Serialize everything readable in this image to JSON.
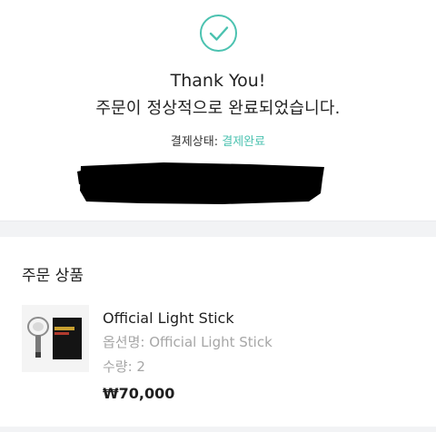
{
  "confirmation": {
    "icon": "check-circle-icon",
    "title": "Thank You!",
    "message": "주문이 정상적으로 완료되었습니다.",
    "payment_status_label": "결제상태: ",
    "payment_status_value": "결제완료",
    "accent_color": "#4bc2b0"
  },
  "order_products": {
    "section_title": "주문 상품",
    "items": [
      {
        "name": "Official Light Stick",
        "option": "옵션명: Official Light Stick",
        "quantity": "수량: 2",
        "price": "₩70,000",
        "thumbnail_icon": "light-stick-product-image"
      }
    ]
  }
}
